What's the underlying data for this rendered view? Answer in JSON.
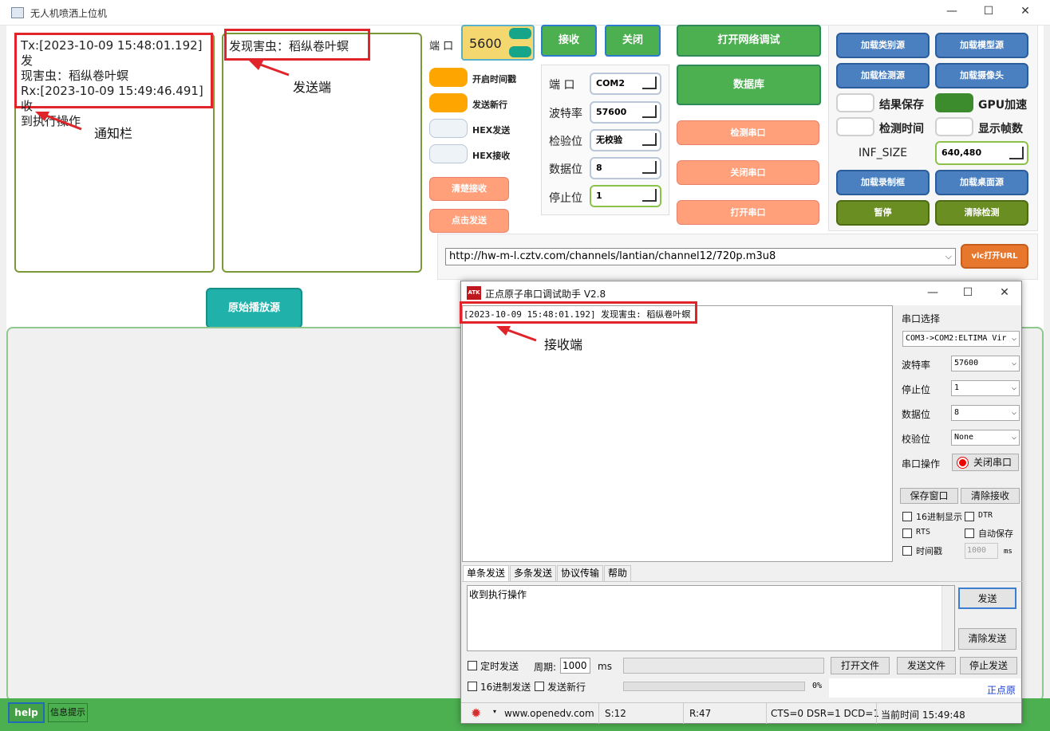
{
  "main_window": {
    "title": "无人机喷洒上位机",
    "controls": {
      "minimize": "—",
      "maximize": "☐",
      "close": "✕"
    }
  },
  "notify": {
    "lines": [
      "Tx:[2023-10-09 15:48:01.192] 发",
      "现害虫：稻纵卷叶螟",
      "Rx:[2023-10-09 15:49:46.491] 收",
      "到执行操作"
    ],
    "annotation": "通知栏"
  },
  "send": {
    "text": "发现害虫：稻纵卷叶螟",
    "annotation": "发送端"
  },
  "port_block": {
    "label": "端 口",
    "value": "5600"
  },
  "toggles": {
    "timestamp": "开启时间戳",
    "newline": "发送新行",
    "hex_send": "HEX发送",
    "hex_recv": "HEX接收"
  },
  "salmon_buttons": {
    "clear_recv": "清楚接收",
    "click_send": "点击发送",
    "detect_serial": "检测串口",
    "close_serial": "关闭串口",
    "open_serial": "打开串口"
  },
  "green_buttons": {
    "receive": "接收",
    "close": "关闭",
    "open_net_debug": "打开网络调试",
    "database": "数据库"
  },
  "serial_settings": {
    "port_label": "端 口",
    "port_value": "COM2",
    "baud_label": "波特率",
    "baud_value": "57600",
    "parity_label": "检验位",
    "parity_value": "无校验",
    "data_label": "数据位",
    "data_value": "8",
    "stop_label": "停止位",
    "stop_value": "1"
  },
  "right_panel": {
    "load_class_src": "加载类别源",
    "load_model_src": "加载模型源",
    "load_detect_src": "加载检测源",
    "load_camera": "加载摄像头",
    "save_result": "结果保存",
    "gpu_accel": "GPU加速",
    "detect_time": "检测时间",
    "show_fps": "显示帧数",
    "inf_size_label": "INF_SIZE",
    "inf_size_value": "640,480",
    "load_record_box": "加载录制框",
    "load_desktop_src": "加载桌面源",
    "pause": "暂停",
    "clear_detect": "清除检测"
  },
  "url_bar": {
    "value": "http://hw-m-l.cztv.com/channels/lantian/channel12/720p.m3u8",
    "vlc_button": "vlc打开URL"
  },
  "raw_source_button": "原始播放源",
  "status_bar": {
    "help": "help",
    "info": "信息提示"
  },
  "serial_tool": {
    "title": "正点原子串口调试助手 V2.8",
    "logo_text": "ATK",
    "received_line": "[2023-10-09 15:48:01.192] 发现害虫: 稻纵卷叶螟",
    "annotation": "接收端",
    "port_select_label": "串口选择",
    "port_select_value": "COM3->COM2:ELTIMA Vir",
    "baud_label": "波特率",
    "baud_value": "57600",
    "stop_label": "停止位",
    "stop_value": "1",
    "data_label": "数据位",
    "data_value": "8",
    "parity_label": "校验位",
    "parity_value": "None",
    "serial_op_label": "串口操作",
    "close_serial": "关闭串口",
    "save_window": "保存窗口",
    "clear_recv": "清除接收",
    "hex_display": "16进制显示",
    "dtr": "DTR",
    "rts": "RTS",
    "auto_save": "自动保存",
    "timestamp": "时间戳",
    "timestamp_value": "1000",
    "ms": "ms",
    "tabs": [
      "单条发送",
      "多条发送",
      "协议传输",
      "帮助"
    ],
    "send_text": "收到执行操作",
    "send_button": "发送",
    "clear_send": "清除发送",
    "timed_send": "定时发送",
    "period_label": "周期:",
    "period_value": "1000",
    "period_unit": "ms",
    "open_file": "打开文件",
    "send_file": "发送文件",
    "stop_send": "停止发送",
    "hex_send": "16进制发送",
    "send_newline": "发送新行",
    "progress": "0%",
    "brand_link": "正点原",
    "status": {
      "site": "www.openedv.com",
      "sent": "S:12",
      "recv": "R:47",
      "lines": "CTS=0 DSR=1 DCD=1",
      "time": "当前时间 15:49:48"
    },
    "controls": {
      "minimize": "—",
      "maximize": "☐",
      "close": "✕"
    }
  }
}
